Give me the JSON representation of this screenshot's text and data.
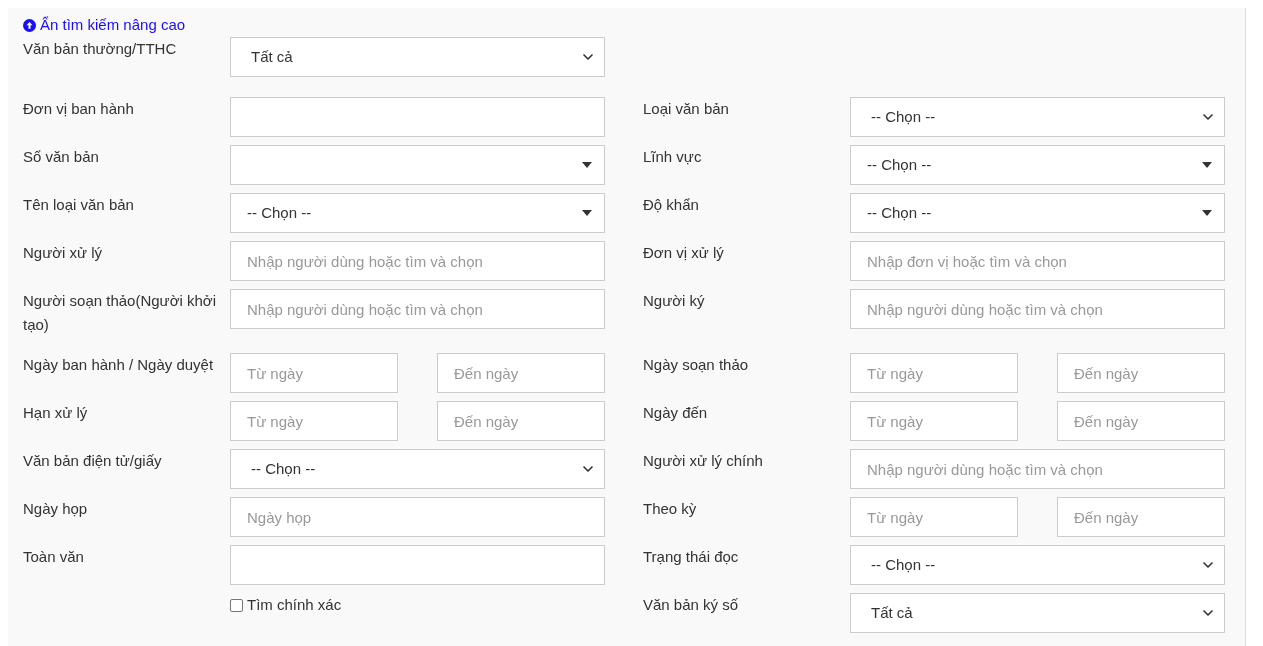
{
  "toggle_link": "Ẩn tìm kiếm nâng cao",
  "rows": [
    {
      "left": {
        "label": "Văn bản thường/TTHC",
        "field": {
          "kind": "select",
          "value": "Tất cả"
        }
      }
    },
    {
      "left": {
        "label": "Đơn vị ban hành",
        "field": {
          "kind": "text"
        }
      },
      "right": {
        "label": "Loại văn bản",
        "field": {
          "kind": "select",
          "value": "-- Chọn --"
        }
      }
    },
    {
      "left": {
        "label": "Sổ văn bản",
        "field": {
          "kind": "combo"
        }
      },
      "right": {
        "label": "Lĩnh vực",
        "field": {
          "kind": "combo",
          "value": "-- Chọn --"
        }
      }
    },
    {
      "left": {
        "label": "Tên loại văn bản",
        "field": {
          "kind": "combo",
          "value": "-- Chọn --"
        }
      },
      "right": {
        "label": "Độ khẩn",
        "field": {
          "kind": "combo",
          "value": "-- Chọn --"
        }
      }
    },
    {
      "left": {
        "label": "Người xử lý",
        "field": {
          "kind": "text",
          "placeholder": "Nhập người dùng hoặc tìm và chọn"
        }
      },
      "right": {
        "label": "Đơn vị xử lý",
        "field": {
          "kind": "text",
          "placeholder": "Nhập đơn vị hoặc tìm và chọn"
        }
      }
    },
    {
      "left": {
        "label": "Người soạn thảo(Người khởi tạo)",
        "field": {
          "kind": "text",
          "placeholder": "Nhập người dùng hoặc tìm và chọn"
        }
      },
      "right": {
        "label": "Người ký",
        "field": {
          "kind": "text",
          "placeholder": "Nhập người dùng hoặc tìm và chọn"
        }
      }
    },
    {
      "left": {
        "label": "Ngày ban hành / Ngày duyệt",
        "field": {
          "kind": "range",
          "from_placeholder": "Từ ngày",
          "to_placeholder": "Đến ngày"
        }
      },
      "right": {
        "label": "Ngày soạn thảo",
        "field": {
          "kind": "range",
          "from_placeholder": "Từ ngày",
          "to_placeholder": "Đến ngày"
        }
      }
    },
    {
      "left": {
        "label": "Hạn xử lý",
        "field": {
          "kind": "range",
          "from_placeholder": "Từ ngày",
          "to_placeholder": "Đến ngày"
        }
      },
      "right": {
        "label": "Ngày đến",
        "field": {
          "kind": "range",
          "from_placeholder": "Từ ngày",
          "to_placeholder": "Đến ngày"
        }
      }
    },
    {
      "left": {
        "label": "Văn bản điện tử/giấy",
        "field": {
          "kind": "select",
          "value": "-- Chọn --"
        }
      },
      "right": {
        "label": "Người xử lý chính",
        "field": {
          "kind": "text",
          "placeholder": "Nhập người dùng hoặc tìm và chọn"
        }
      }
    },
    {
      "left": {
        "label": "Ngày họp",
        "field": {
          "kind": "text",
          "placeholder": "Ngày họp"
        }
      },
      "right": {
        "label": "Theo kỳ",
        "field": {
          "kind": "range",
          "from_placeholder": "Từ ngày",
          "to_placeholder": "Đến ngày"
        }
      }
    },
    {
      "left": {
        "label": "Toàn văn",
        "field": {
          "kind": "text"
        }
      },
      "right": {
        "label": "Trạng thái đọc",
        "field": {
          "kind": "select",
          "value": "-- Chọn --"
        }
      }
    },
    {
      "left": {
        "field": {
          "kind": "checkbox",
          "label": "Tìm chính xác",
          "checked": false
        }
      },
      "right": {
        "label": "Văn bản ký số",
        "field": {
          "kind": "select",
          "value": "Tất cả"
        }
      }
    }
  ]
}
